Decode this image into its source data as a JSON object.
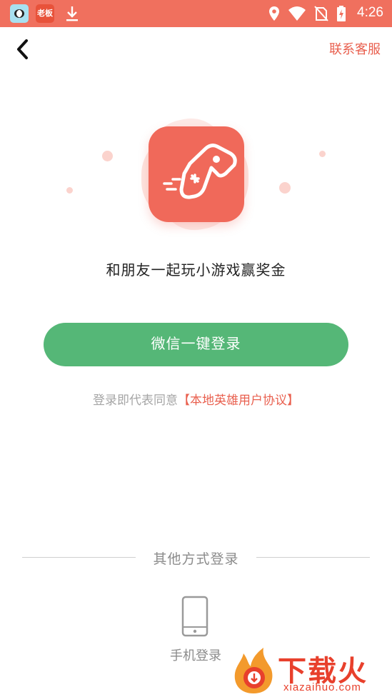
{
  "status_bar": {
    "time": "4:26",
    "apps": [
      {
        "name": "panda-app-icon"
      },
      {
        "name": "laoban-app-icon",
        "label": "老板"
      },
      {
        "name": "download-icon"
      }
    ],
    "icons": [
      "location-icon",
      "wifi-icon",
      "no-sim-icon",
      "battery-charging-icon"
    ]
  },
  "header": {
    "back_icon": "chevron-left-icon",
    "contact_label": "联系客服"
  },
  "hero": {
    "icon": "gamepad-icon",
    "slogan": "和朋友一起玩小游戏赢奖金"
  },
  "login": {
    "wechat_button_label": "微信一键登录",
    "agreement_prefix": "登录即代表同意",
    "agreement_link": "【本地英雄用户协议】"
  },
  "other_login": {
    "title": "其他方式登录",
    "phone_label": "手机登录",
    "phone_icon": "smartphone-icon"
  },
  "watermark": {
    "text": "下载火",
    "sub": "xiazaihuo.com"
  },
  "colors": {
    "status_bar": "#f0705e",
    "accent": "#e9604f",
    "wechat_green": "#55b777",
    "muted_text": "#a5a5a5"
  }
}
